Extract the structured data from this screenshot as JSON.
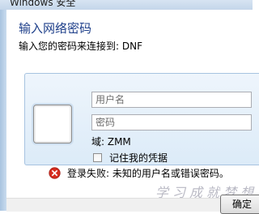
{
  "window": {
    "title": "Windows 安全"
  },
  "dialog": {
    "heading": "输入网络密码",
    "subtext": "输入您的密码来连接到: DNF"
  },
  "credentials": {
    "username_placeholder": "用户名",
    "username_value": "",
    "password_placeholder": "密码",
    "password_value": "",
    "domain_text": "域: ZMM",
    "remember_label": "记住我的凭据",
    "remember_checked": false
  },
  "error": {
    "message": "登录失败: 未知的用户名或错误密码。",
    "icon": "error-icon"
  },
  "buttons": {
    "ok_label": "确定"
  },
  "watermark": {
    "text": "学习成就梦想"
  },
  "colors": {
    "heading": "#1e3f8a",
    "panel": "#dcebf8",
    "error_red": "#d62d20"
  }
}
